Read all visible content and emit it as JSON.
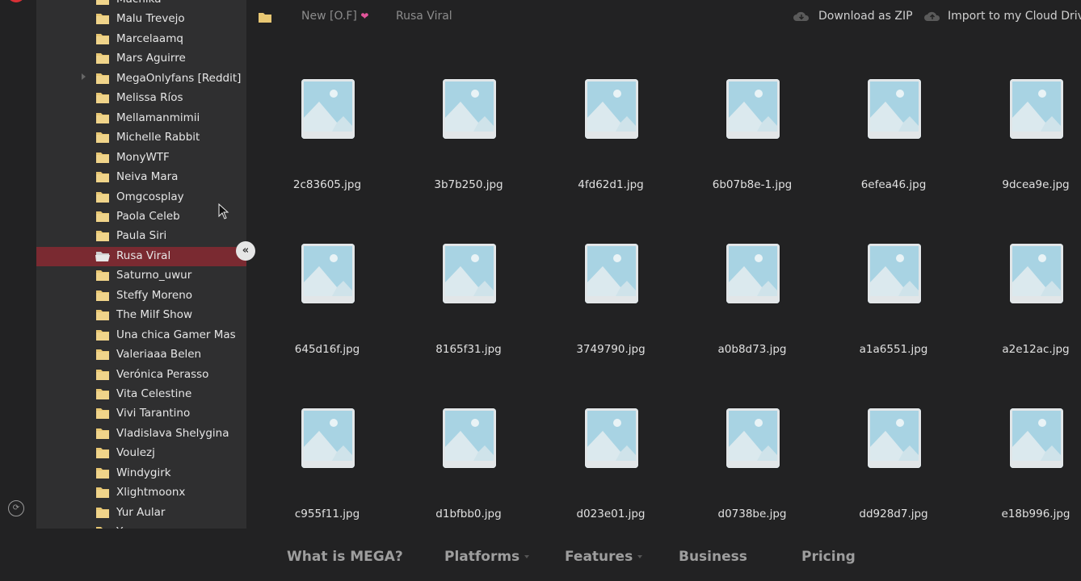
{
  "sidebar": {
    "items": [
      {
        "label": "Machika"
      },
      {
        "label": "Malu Trevejo"
      },
      {
        "label": "Marcelaamq"
      },
      {
        "label": "Mars Aguirre"
      },
      {
        "label": "MegaOnlyfans [Reddit]"
      },
      {
        "label": "Melissa Ríos"
      },
      {
        "label": "Mellamanmimii"
      },
      {
        "label": "Michelle Rabbit"
      },
      {
        "label": "MonyWTF"
      },
      {
        "label": "Neiva Mara"
      },
      {
        "label": "Omgcosplay"
      },
      {
        "label": "Paola Celeb"
      },
      {
        "label": "Paula Siri"
      },
      {
        "label": "Rusa Viral"
      },
      {
        "label": "Saturno_uwur"
      },
      {
        "label": "Steffy Moreno"
      },
      {
        "label": "The Milf Show"
      },
      {
        "label": "Una chica Gamer Mas"
      },
      {
        "label": "Valeriaaa Belen"
      },
      {
        "label": "Verónica Perasso"
      },
      {
        "label": "Vita Celestine"
      },
      {
        "label": "Vivi Tarantino"
      },
      {
        "label": "Vladislava Shelygina"
      },
      {
        "label": "Voulezj"
      },
      {
        "label": "Windygirk"
      },
      {
        "label": "Xlightmoonx"
      },
      {
        "label": "Yur Aular"
      },
      {
        "label": "Yuz..."
      }
    ],
    "selected": "Rusa Viral",
    "collapse_glyph": "«"
  },
  "breadcrumb": {
    "parent": "New [O.F]",
    "heart": "❤",
    "current": "Rusa Viral"
  },
  "actions": {
    "download_zip": "Download as ZIP",
    "import_cloud": "Import to my Cloud Drive"
  },
  "files": [
    "2c83605.jpg",
    "3b7b250.jpg",
    "4fd62d1.jpg",
    "6b07b8e-1.jpg",
    "6efea46.jpg",
    "9dcea9e.jpg",
    "645d16f.jpg",
    "8165f31.jpg",
    "3749790.jpg",
    "a0b8d73.jpg",
    "a1a6551.jpg",
    "a2e12ac.jpg",
    "c955f11.jpg",
    "d1bfbb0.jpg",
    "d023e01.jpg",
    "d0738be.jpg",
    "dd928d7.jpg",
    "e18b996.jpg"
  ],
  "footer_nav": {
    "what_is": "What is MEGA?",
    "platforms": "Platforms",
    "features": "Features",
    "business": "Business",
    "pricing": "Pricing"
  },
  "colors": {
    "background": "#222223",
    "sidebar": "#2f2f30",
    "selected_row": "#7a2a31",
    "folder": "#e8c773",
    "thumb_sky": "#a8d3e3",
    "brand_red": "#d93036"
  }
}
